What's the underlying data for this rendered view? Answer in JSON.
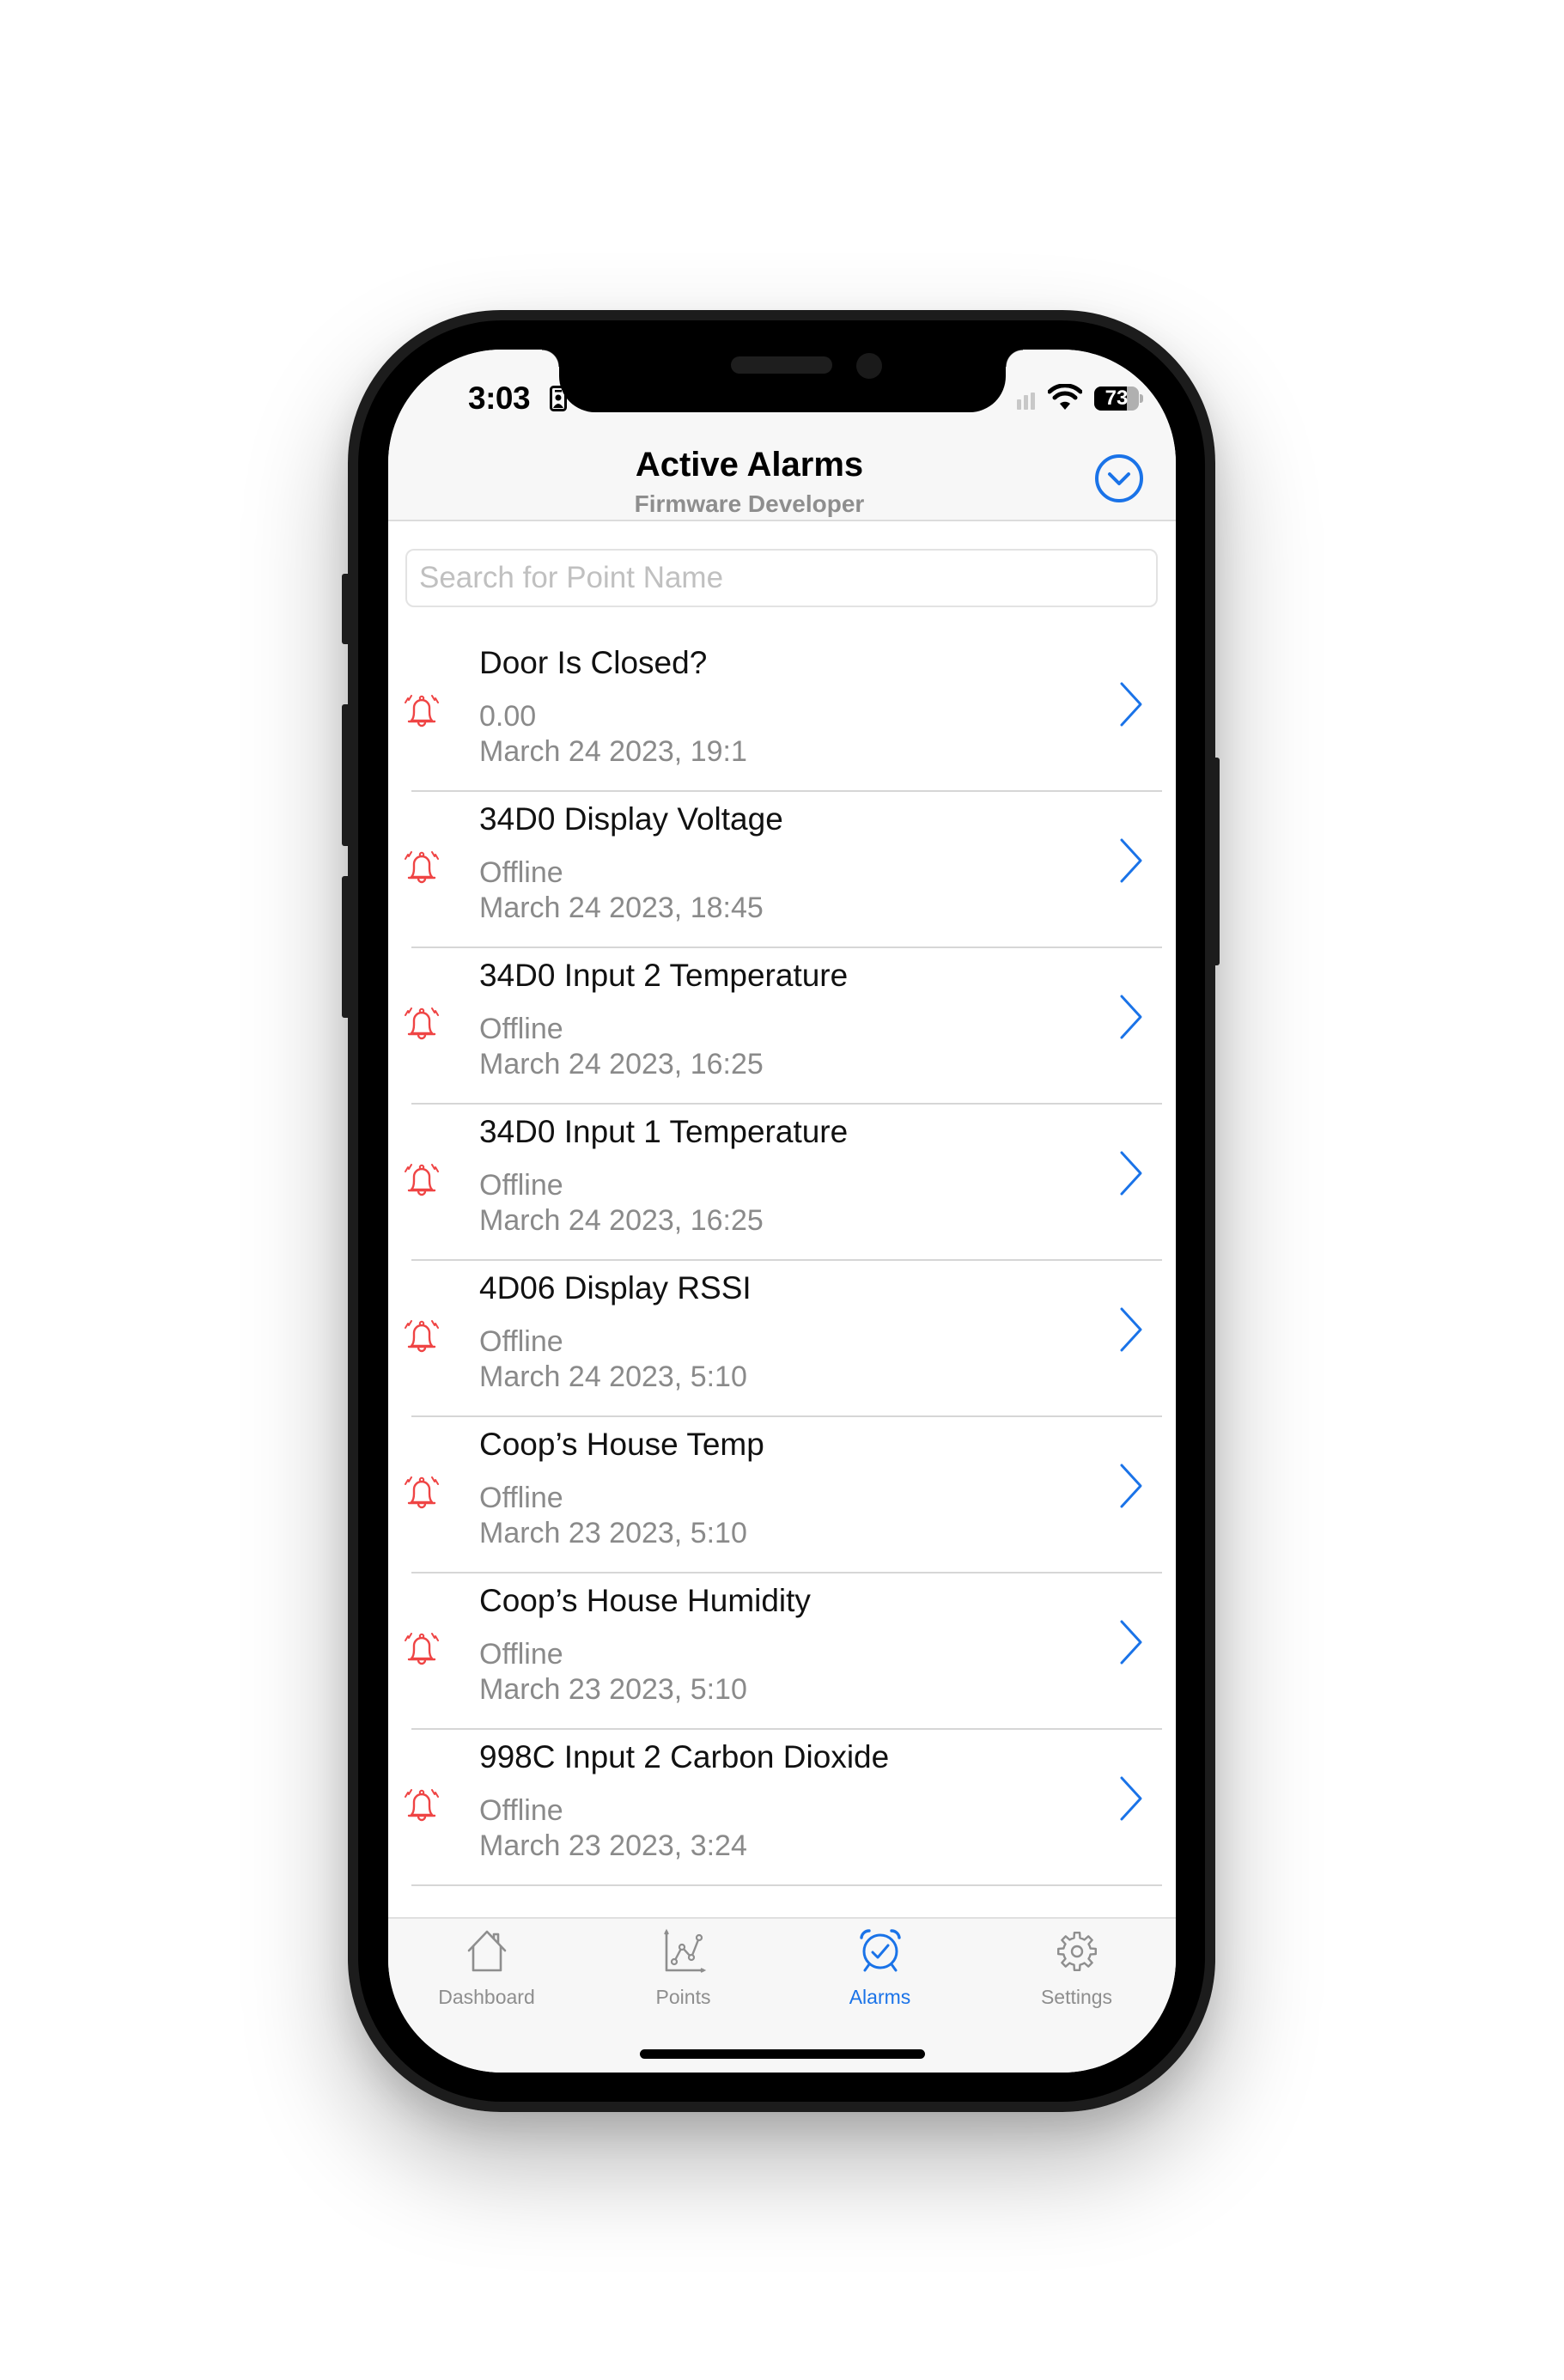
{
  "status_bar": {
    "time": "3:03",
    "battery_percent": 73,
    "battery_label": "73"
  },
  "header": {
    "title": "Active Alarms",
    "subtitle": "Firmware Developer",
    "action_icon": "chevron-down-circle-icon"
  },
  "search": {
    "placeholder": "Search for Point Name",
    "value": ""
  },
  "colors": {
    "accent": "#1a73e8",
    "alarm": "#ef4444",
    "secondary_text": "#8a8a8a"
  },
  "alarms": [
    {
      "name": "Door Is Closed?",
      "value": "0.00",
      "timestamp": "March 24 2023, 19:1",
      "icon": "alarm-bell-icon"
    },
    {
      "name": "34D0 Display Voltage",
      "value": "Offline",
      "timestamp": "March 24 2023, 18:45",
      "icon": "alarm-bell-icon"
    },
    {
      "name": "34D0 Input 2 Temperature",
      "value": "Offline",
      "timestamp": "March 24 2023, 16:25",
      "icon": "alarm-bell-icon"
    },
    {
      "name": "34D0 Input 1 Temperature",
      "value": "Offline",
      "timestamp": "March 24 2023, 16:25",
      "icon": "alarm-bell-icon"
    },
    {
      "name": "4D06 Display RSSI",
      "value": "Offline",
      "timestamp": "March 24 2023, 5:10",
      "icon": "alarm-bell-icon"
    },
    {
      "name": "Coop’s House Temp",
      "value": "Offline",
      "timestamp": "March 23 2023, 5:10",
      "icon": "alarm-bell-icon"
    },
    {
      "name": "Coop’s House Humidity",
      "value": "Offline",
      "timestamp": "March 23 2023, 5:10",
      "icon": "alarm-bell-icon"
    },
    {
      "name": "998C Input 2 Carbon Dioxide",
      "value": "Offline",
      "timestamp": "March 23 2023, 3:24",
      "icon": "alarm-bell-icon"
    }
  ],
  "tabs": [
    {
      "label": "Dashboard",
      "icon": "house-icon",
      "active": false
    },
    {
      "label": "Points",
      "icon": "line-chart-icon",
      "active": false
    },
    {
      "label": "Alarms",
      "icon": "alarm-clock-check-icon",
      "active": true
    },
    {
      "label": "Settings",
      "icon": "gear-icon",
      "active": false
    }
  ]
}
